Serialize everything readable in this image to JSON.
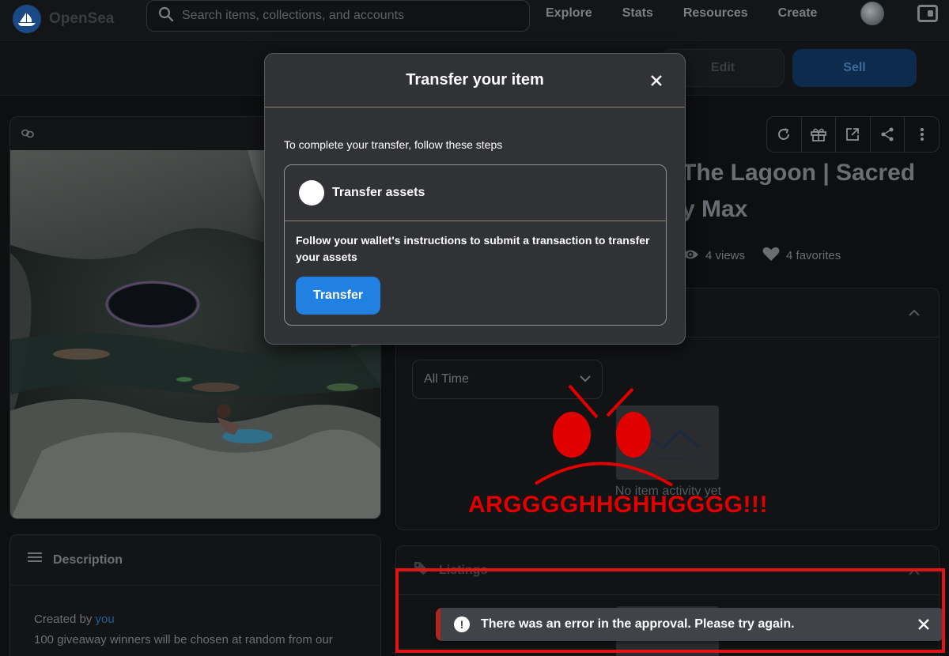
{
  "nav": {
    "brand": "OpenSea",
    "search_placeholder": "Search items, collections, and accounts",
    "links": [
      "Explore",
      "Stats",
      "Resources",
      "Create"
    ]
  },
  "actions": {
    "edit_label": "Edit",
    "sell_label": "Sell"
  },
  "item": {
    "title": "The Lagoon | Sacred ...y Max",
    "title_line1": "The Lagoon | Sacred",
    "title_line2": "y Max",
    "views": "4 views",
    "favorites": "4 favorites"
  },
  "description": {
    "header": "Description",
    "created_by_prefix": "Created by",
    "creator": "you",
    "text": "100 giveaway winners will be chosen at random from our"
  },
  "activity": {
    "filter_value": "All Time",
    "empty_text": "No item activity yet"
  },
  "listings": {
    "header": "Listings"
  },
  "modal": {
    "title": "Transfer your item",
    "subtitle": "To complete your transfer, follow these steps",
    "step_label": "Transfer assets",
    "step_text": "Follow your wallet's instructions to submit a transaction to transfer your assets",
    "transfer_button": "Transfer"
  },
  "toast": {
    "message": "There was an error in the approval. Please try again."
  },
  "annotation": {
    "text": "ARGGGGHHGHHGGGG!!!"
  },
  "colors": {
    "accent": "#2081e2",
    "annotation_red": "#e00000",
    "error_red": "#b3261e"
  }
}
